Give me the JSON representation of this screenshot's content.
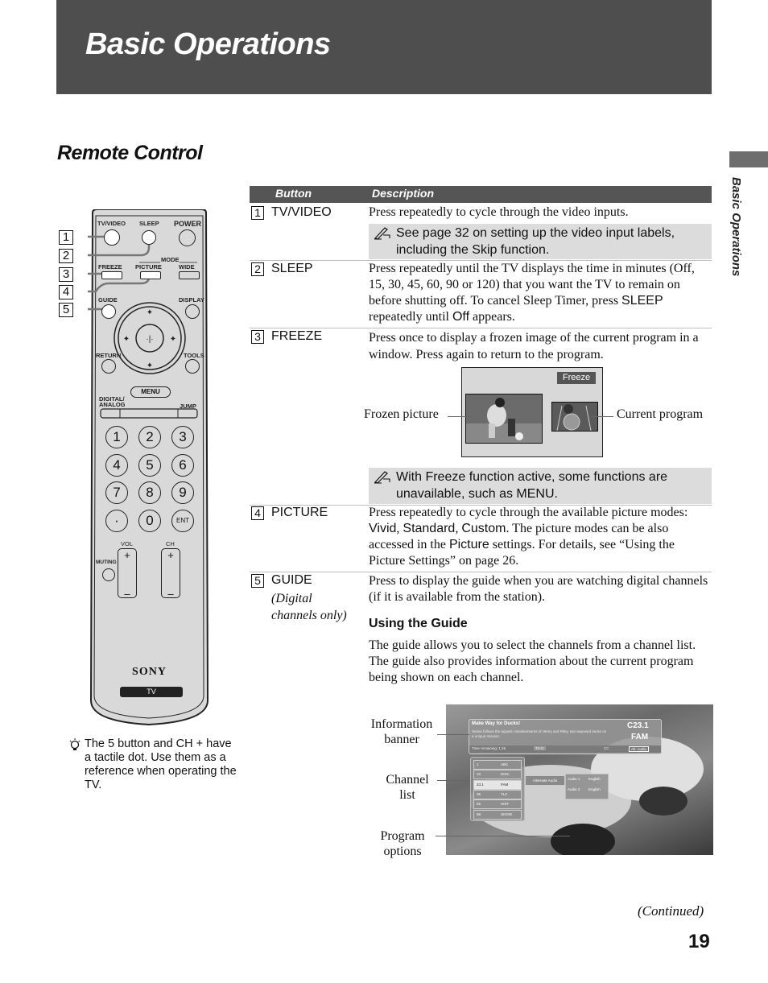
{
  "header": {
    "title": "Basic Operations"
  },
  "section": {
    "title": "Remote Control"
  },
  "side_tab": {
    "label": "Basic Operations"
  },
  "table": {
    "headers": {
      "button": "Button",
      "description": "Description"
    },
    "rows": [
      {
        "num": "1",
        "button": "TV/VIDEO",
        "description": "Press repeatedly to cycle through the video inputs.",
        "note": "See page 32 on setting up the video input labels, including the Skip function."
      },
      {
        "num": "2",
        "button": "SLEEP",
        "description_parts": [
          "Press repeatedly until the TV displays the time in minutes (Off, 15, 30, 45, 60, 90 or 120) that you want the TV to remain on before shutting off. To cancel Sleep Timer, press ",
          "SLEEP",
          " repeatedly until ",
          "Off",
          " appears."
        ]
      },
      {
        "num": "3",
        "button": "FREEZE",
        "description": "Press once to display a frozen image of the current program in a window. Press again to return to the program.",
        "note": "With Freeze function active, some functions are unavailable, such as MENU."
      },
      {
        "num": "4",
        "button": "PICTURE",
        "description_parts": [
          "Press repeatedly to cycle through the available picture modes: ",
          "Vivid",
          ", ",
          "Standard",
          ", ",
          "Custom",
          ". The picture modes can be also accessed in the ",
          "Picture",
          " settings. For details, see “Using the Picture Settings” on page 26."
        ]
      },
      {
        "num": "5",
        "button": "GUIDE",
        "button_sub": "(Digital channels only)",
        "description": "Press to display the guide when you are watching digital channels (if it is available from the station).",
        "subheading": "Using the Guide",
        "body": "The guide allows you to select the channels from a channel list. The guide also provides information about the current program being shown on each channel."
      }
    ]
  },
  "freeze_figure": {
    "badge": "Freeze",
    "left_callout": "Frozen picture",
    "right_callout": "Current program"
  },
  "guide_figure": {
    "callouts": [
      "Information banner",
      "Channel list",
      "Program options"
    ],
    "banner": {
      "program_title": "Make Way for Ducks!",
      "synopsis": "Series follows the aquatic misadventures of Henry and Riley, two wayward ducks on a unique mission.",
      "time_remaining": "Time remaining: 1:26",
      "rating": "TV-G",
      "cc": "CC",
      "channel_number": "C23.1",
      "channel_name": "FAM",
      "alt_audio": "Alt. Audio"
    },
    "channels": [
      {
        "num": "1",
        "name": "ABC"
      },
      {
        "num": "10",
        "name": "DISC"
      },
      {
        "num": "23.1",
        "name": "FAM",
        "selected": true
      },
      {
        "num": "35",
        "name": "TLC"
      },
      {
        "num": "65",
        "name": "HIST"
      },
      {
        "num": "68",
        "name": "SHOW"
      }
    ],
    "option_label": "Alternate Audio",
    "audio_options": [
      {
        "label": "Audio 1",
        "value": "English"
      },
      {
        "label": "Audio 2",
        "value": "English"
      }
    ]
  },
  "remote": {
    "brand": "SONY",
    "mode_badge": "TV",
    "labels": {
      "tv_video": "TV/VIDEO",
      "sleep": "SLEEP",
      "power": "POWER",
      "mode": "MODE",
      "freeze": "FREEZE",
      "picture": "PICTURE",
      "wide": "WIDE",
      "guide": "GUIDE",
      "display": "DISPLAY",
      "return": "RETURN",
      "tools": "TOOLS",
      "menu": "MENU",
      "digital_analog": "DIGITAL/ ANALOG",
      "jump": "JUMP",
      "vol": "VOL",
      "ch": "CH",
      "muting": "MUTING",
      "ent": "ENT"
    },
    "numkeys": [
      "1",
      "2",
      "3",
      "4",
      "5",
      "6",
      "7",
      "8",
      "9",
      "·",
      "0",
      "ENT"
    ],
    "callout_numbers": [
      "1",
      "2",
      "3",
      "4",
      "5"
    ]
  },
  "tip": {
    "text": "The 5 button and CH + have a tactile dot. Use them as a reference when operating the TV."
  },
  "footer": {
    "continued": "(Continued)",
    "page_number": "19"
  }
}
